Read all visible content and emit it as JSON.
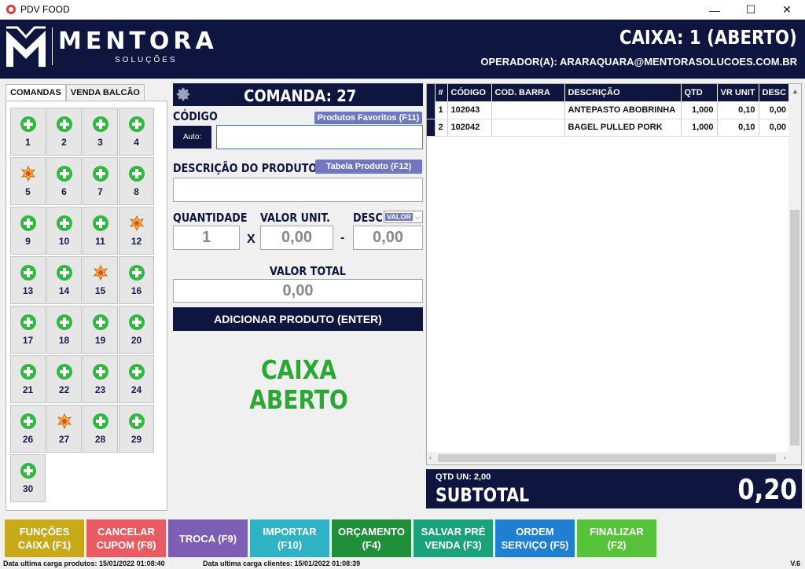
{
  "window": {
    "title": "PDV FOOD",
    "minimize": "—",
    "maximize": "☐",
    "close": "✕"
  },
  "header": {
    "brand": "MENTORA",
    "brand_sub": "SOLUÇÕES",
    "caixa_status": "CAIXA: 1 (ABERTO)",
    "operador": "OPERADOR(A): ARARAQUARA@MENTORASOLUCOES.COM.BR"
  },
  "tabs": [
    "COMANDAS",
    "VENDA BALCÃO"
  ],
  "comandas": [
    {
      "n": "1",
      "busy": false
    },
    {
      "n": "2",
      "busy": false
    },
    {
      "n": "3",
      "busy": false
    },
    {
      "n": "4",
      "busy": false
    },
    {
      "n": "5",
      "busy": true
    },
    {
      "n": "6",
      "busy": false
    },
    {
      "n": "7",
      "busy": false
    },
    {
      "n": "8",
      "busy": false
    },
    {
      "n": "9",
      "busy": false
    },
    {
      "n": "10",
      "busy": false
    },
    {
      "n": "11",
      "busy": false
    },
    {
      "n": "12",
      "busy": true
    },
    {
      "n": "13",
      "busy": false
    },
    {
      "n": "14",
      "busy": false
    },
    {
      "n": "15",
      "busy": true
    },
    {
      "n": "16",
      "busy": false
    },
    {
      "n": "17",
      "busy": false
    },
    {
      "n": "18",
      "busy": false
    },
    {
      "n": "19",
      "busy": false
    },
    {
      "n": "20",
      "busy": false
    },
    {
      "n": "21",
      "busy": false
    },
    {
      "n": "22",
      "busy": false
    },
    {
      "n": "23",
      "busy": false
    },
    {
      "n": "24",
      "busy": false
    },
    {
      "n": "26",
      "busy": false
    },
    {
      "n": "27",
      "busy": true
    },
    {
      "n": "28",
      "busy": false
    },
    {
      "n": "29",
      "busy": false
    },
    {
      "n": "30",
      "busy": false
    }
  ],
  "form": {
    "comanda_title": "COMANDA: 27",
    "codigo_label": "CÓDIGO",
    "favoritos_btn": "Produtos Favoritos (F11)",
    "auto_label": "Auto:",
    "codigo_value": "",
    "descricao_label": "DESCRIÇÃO DO PRODUTO",
    "tabela_btn": "Tabela Produto (F12)",
    "descricao_value": "",
    "quantidade_label": "QUANTIDADE",
    "valor_unit_label": "VALOR UNIT.",
    "desc_label": "DESC",
    "desc_type": "VALOR",
    "quantidade": "1",
    "times": "X",
    "valor_unit": "0,00",
    "minus": "-",
    "desc_value": "0,00",
    "valor_total_label": "VALOR TOTAL",
    "valor_total": "0,00",
    "add_btn": "ADICIONAR PRODUTO (ENTER)",
    "status_line1": "CAIXA",
    "status_line2": "ABERTO"
  },
  "table": {
    "columns": [
      "#",
      "CÓDIGO",
      "COD. BARRA",
      "DESCRIÇÃO",
      "QTD",
      "VR UNIT",
      "DESC"
    ],
    "rows": [
      [
        "1",
        "102043",
        "",
        "ANTEPASTO  ABOBRINHA",
        "1,000",
        "0,10",
        "0,00"
      ],
      [
        "2",
        "102042",
        "",
        "BAGEL PULLED PORK",
        "1,000",
        "0,10",
        "0,00"
      ]
    ]
  },
  "subtotal": {
    "qtd": "QTD UN: 2,00",
    "label": "SUBTOTAL",
    "value": "0,20"
  },
  "functions": [
    {
      "label": "FUNÇÕES\nCAIXA (F1)",
      "color": "#c8a91a"
    },
    {
      "label": "CANCELAR\nCUPOM (F8)",
      "color": "#e85b63"
    },
    {
      "label": "TROCA (F9)",
      "color": "#7c5eb3"
    },
    {
      "label": "IMPORTAR\n(F10)",
      "color": "#2fb2c4"
    },
    {
      "label": "ORÇAMENTO\n(F4)",
      "color": "#1f8f3a"
    },
    {
      "label": "SALVAR PRÉ\nVENDA (F3)",
      "color": "#1aa37a"
    },
    {
      "label": "ORDEM\nSERVIÇO (F5)",
      "color": "#1f7fd0"
    },
    {
      "label": "FINALIZAR\n(F2)",
      "color": "#56c33a"
    }
  ],
  "statusbar": {
    "produtos": "Data ultima carga produtos: 15/01/2022 01:08:40",
    "clientes": "Data ultima carga clientes: 15/01/2022 01:08:39",
    "version": "V.6"
  }
}
